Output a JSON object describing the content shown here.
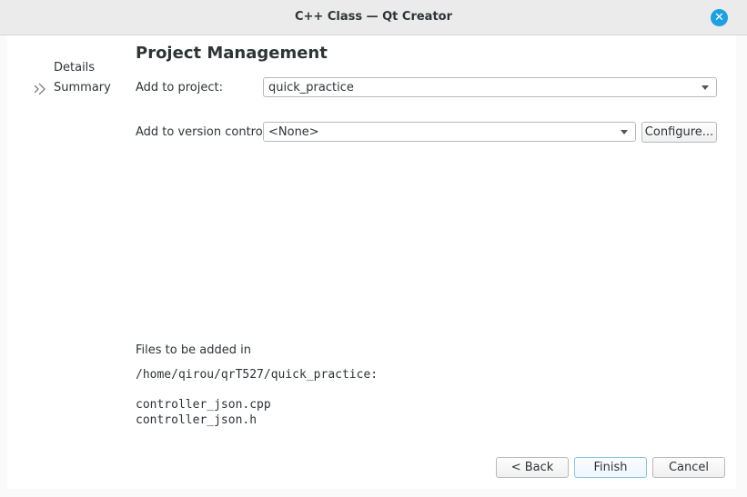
{
  "window": {
    "title": "C++ Class — Qt Creator"
  },
  "steps": [
    {
      "label": "Details"
    },
    {
      "label": "Summary"
    }
  ],
  "page": {
    "title": "Project Management"
  },
  "fields": {
    "project_label": "Add to project:",
    "project_value": "quick_practice",
    "vcs_label": "Add to version control:",
    "vcs_value": "<None>",
    "configure_label": "Configure..."
  },
  "files": {
    "heading": "Files to be added in",
    "path": "/home/qirou/qrT527/quick_practice:",
    "list": [
      "controller_json.cpp",
      "controller_json.h"
    ]
  },
  "buttons": {
    "back": "< Back",
    "finish": "Finish",
    "cancel": "Cancel"
  },
  "colors": {
    "accent": "#1ba0e1"
  }
}
